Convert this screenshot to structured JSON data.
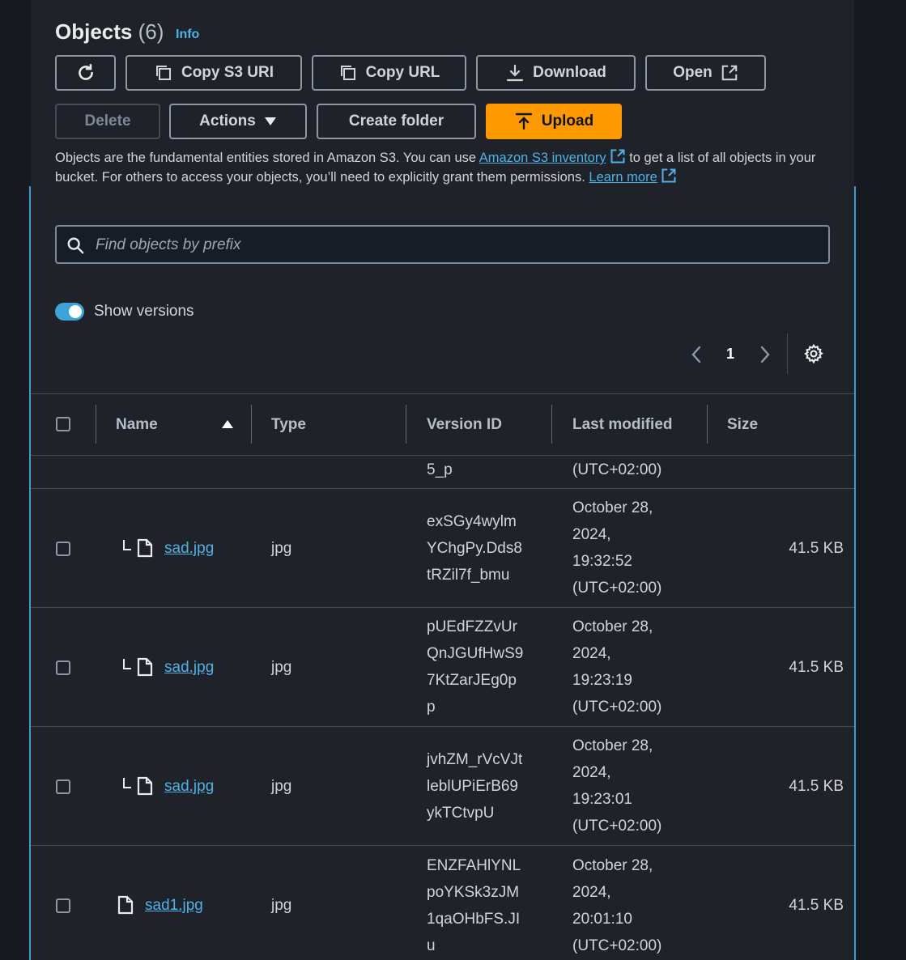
{
  "header": {
    "title": "Objects",
    "count": "(6)",
    "info": "Info"
  },
  "toolbar": {
    "copy_s3_uri": "Copy S3 URI",
    "copy_url": "Copy URL",
    "download": "Download",
    "open": "Open",
    "delete": "Delete",
    "actions": "Actions",
    "create_folder": "Create folder",
    "upload": "Upload"
  },
  "description": {
    "part1": "Objects are the fundamental entities stored in Amazon S3. You can use ",
    "inventory_link": "Amazon S3 inventory",
    "part2": " to get a list of all objects in your bucket. For others to access your objects, you’ll need to explicitly grant them permissions. ",
    "learn_more": "Learn more"
  },
  "search": {
    "placeholder": "Find objects by prefix",
    "value": ""
  },
  "show_versions": {
    "label": "Show versions",
    "on": true
  },
  "pagination": {
    "current_page": "1"
  },
  "table": {
    "columns": [
      "Name",
      "Type",
      "Version ID",
      "Last modified",
      "Size"
    ],
    "partial_row": {
      "version_tail": "5_p",
      "modified_tail": "(UTC+02:00)"
    },
    "rows": [
      {
        "name": "sad.jpg",
        "is_version": true,
        "type": "jpg",
        "version_lines": [
          "exSGy4wylm",
          "YChgPy.Dds8",
          "tRZil7f_bmu"
        ],
        "modified_lines": [
          "October 28,",
          "2024,",
          "19:32:52",
          "(UTC+02:00)"
        ],
        "size": "41.5 KB"
      },
      {
        "name": "sad.jpg",
        "is_version": true,
        "type": "jpg",
        "version_lines": [
          "pUEdFZZvUr",
          "QnJGUfHwS9",
          "7KtZarJEg0p",
          "p"
        ],
        "modified_lines": [
          "October 28,",
          "2024,",
          "19:23:19",
          "(UTC+02:00)"
        ],
        "size": "41.5 KB"
      },
      {
        "name": "sad.jpg",
        "is_version": true,
        "type": "jpg",
        "version_lines": [
          "jvhZM_rVcVJt",
          "leblUPiErB69",
          "ykTCtvpU"
        ],
        "modified_lines": [
          "October 28,",
          "2024,",
          "19:23:01",
          "(UTC+02:00)"
        ],
        "size": "41.5 KB"
      },
      {
        "name": "sad1.jpg",
        "is_version": false,
        "type": "jpg",
        "version_lines": [
          "ENZFAHlYNL",
          "poYKSk3zJM",
          "1qaOHbFS.JI",
          "u"
        ],
        "modified_lines": [
          "October 28,",
          "2024,",
          "20:01:10",
          "(UTC+02:00)"
        ],
        "size": "41.5 KB"
      }
    ]
  },
  "colors": {
    "accent": "#ff9900",
    "link": "#4fb1e8",
    "panel": "#1f2329",
    "border_highlight": "#3b9ccf"
  }
}
